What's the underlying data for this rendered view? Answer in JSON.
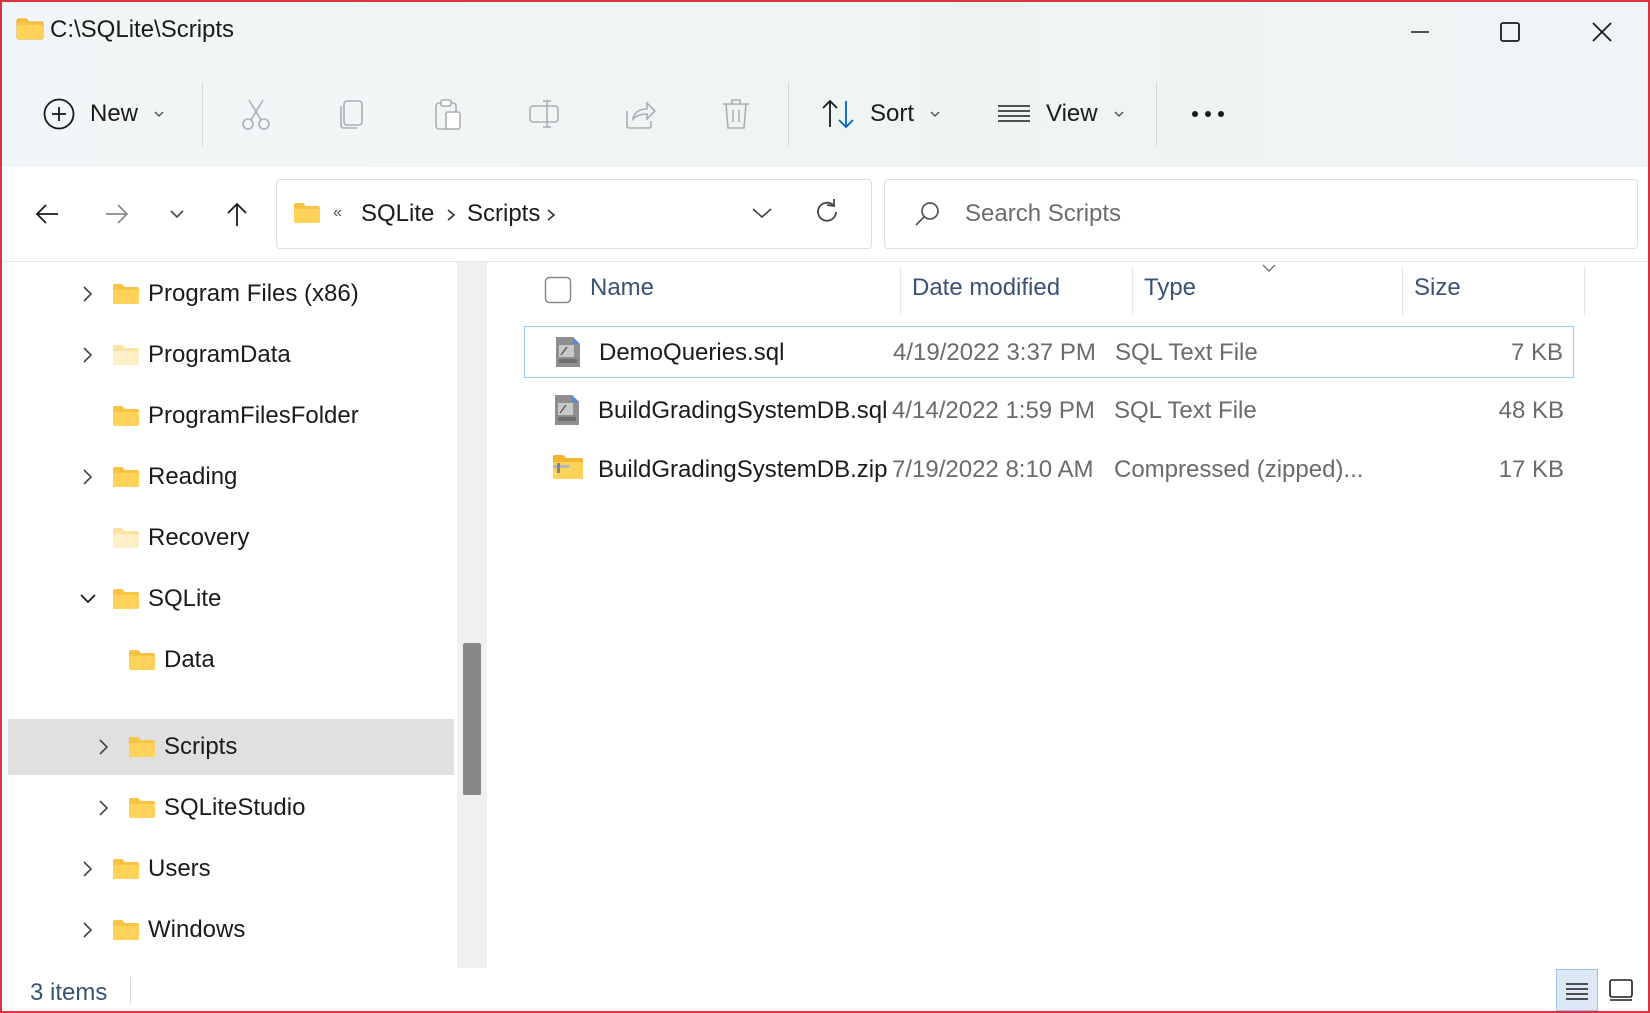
{
  "window": {
    "title": "C:\\SQLite\\Scripts"
  },
  "window_controls": {
    "minimize": "minimize",
    "maximize": "maximize",
    "close": "close"
  },
  "toolbar": {
    "new_label": "New",
    "sort_label": "Sort",
    "view_label": "View",
    "icons": [
      "cut-icon",
      "copy-icon",
      "paste-icon",
      "rename-icon",
      "share-icon",
      "delete-icon"
    ]
  },
  "address": {
    "overflow": "«",
    "crumbs": [
      "SQLite",
      "Scripts"
    ]
  },
  "search": {
    "placeholder": "Search Scripts"
  },
  "tree": {
    "items": [
      {
        "label": "Program Files (x86)",
        "level": 0,
        "expander": "collapsed"
      },
      {
        "label": "ProgramData",
        "level": 0,
        "expander": "collapsed",
        "pale": true
      },
      {
        "label": "ProgramFilesFolder",
        "level": 0,
        "expander": "none"
      },
      {
        "label": "Reading",
        "level": 0,
        "expander": "collapsed"
      },
      {
        "label": "Recovery",
        "level": 0,
        "expander": "none",
        "pale": true
      },
      {
        "label": "SQLite",
        "level": 0,
        "expander": "expanded"
      },
      {
        "label": "Data",
        "level": 1,
        "expander": "none"
      },
      {
        "label": "Scripts",
        "level": 1,
        "expander": "collapsed",
        "selected": true
      },
      {
        "label": "SQLiteStudio",
        "level": 1,
        "expander": "collapsed"
      },
      {
        "label": "Users",
        "level": 0,
        "expander": "collapsed"
      },
      {
        "label": "Windows",
        "level": 0,
        "expander": "collapsed"
      }
    ]
  },
  "details": {
    "columns": {
      "name": "Name",
      "date": "Date modified",
      "type": "Type",
      "size": "Size"
    },
    "sorted_column": "type",
    "files": [
      {
        "name": "DemoQueries.sql",
        "date": "4/19/2022 3:37 PM",
        "type": "SQL Text File",
        "size": "7 KB",
        "icon": "sql-file-icon",
        "selected": true
      },
      {
        "name": "BuildGradingSystemDB.sql",
        "date": "4/14/2022 1:59 PM",
        "type": "SQL Text File",
        "size": "48 KB",
        "icon": "sql-file-icon"
      },
      {
        "name": "BuildGradingSystemDB.zip",
        "date": "7/19/2022 8:10 AM",
        "type": "Compressed (zipped)...",
        "size": "17 KB",
        "icon": "zip-folder-icon"
      }
    ]
  },
  "status": {
    "count": "3 items"
  },
  "colors": {
    "accent": "#0067c0",
    "border": "#d9343f",
    "folder": "#f8c443",
    "selection": "#e0e0e0"
  }
}
